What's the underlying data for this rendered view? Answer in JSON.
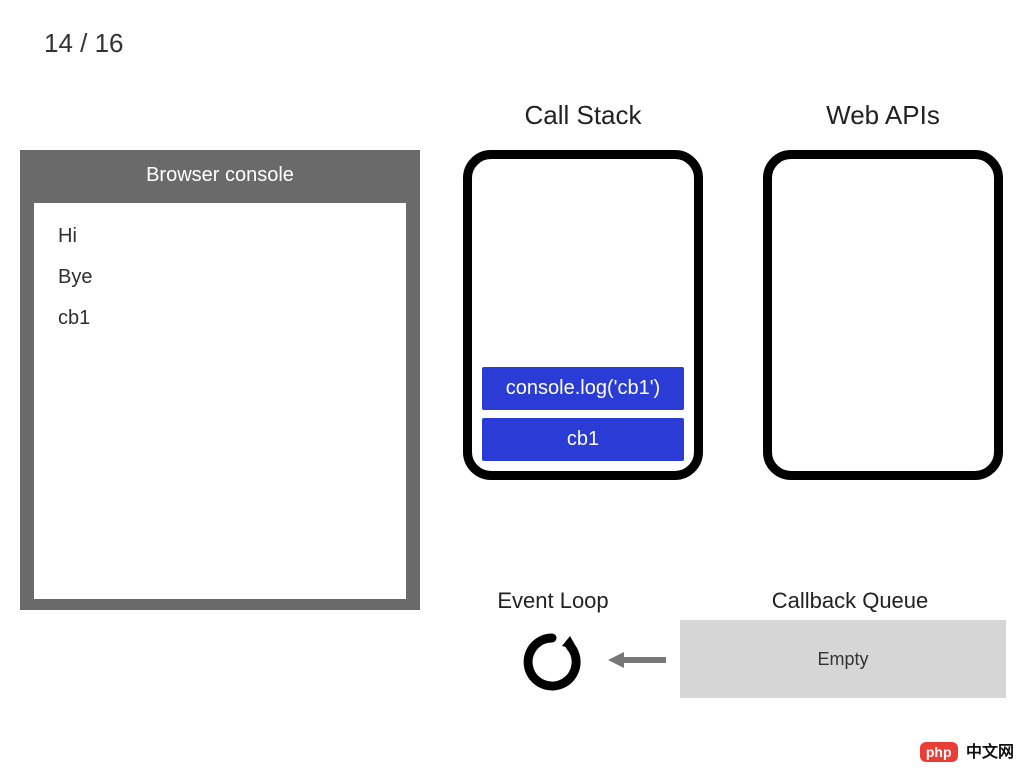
{
  "counter": "14 / 16",
  "console": {
    "title": "Browser console",
    "lines": [
      "Hi",
      "Bye",
      "cb1"
    ]
  },
  "call_stack": {
    "title": "Call Stack",
    "frames": [
      "console.log('cb1')",
      "cb1"
    ]
  },
  "web_apis": {
    "title": "Web APIs"
  },
  "event_loop": {
    "title": "Event Loop"
  },
  "callback_queue": {
    "title": "Callback Queue",
    "content": "Empty"
  },
  "watermark": {
    "badge": "php",
    "text": "中文网"
  },
  "colors": {
    "frame_bg": "#2a3bd6",
    "cbq_bg": "#d6d6d6",
    "console_chrome": "#6a6a6a"
  }
}
